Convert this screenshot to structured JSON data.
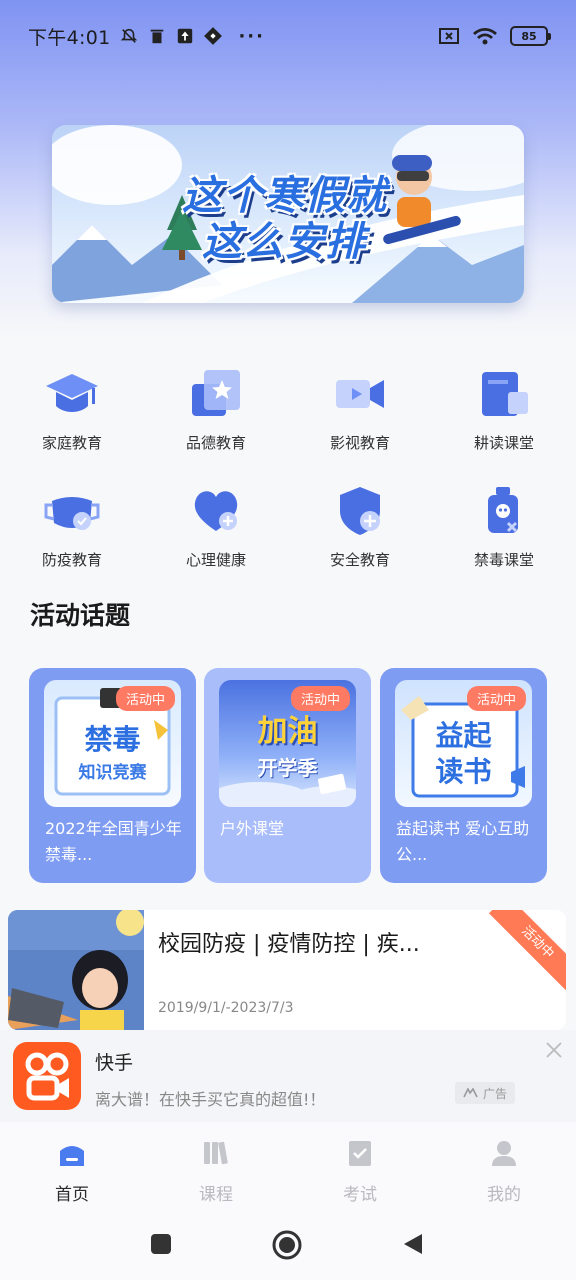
{
  "status_bar": {
    "time": "下午4:01",
    "dots": "···",
    "battery": "85"
  },
  "banner": {
    "line1": "这个寒假就",
    "line2": "这么安排"
  },
  "categories": [
    {
      "label": "家庭教育",
      "icon": "graduation-cap-icon"
    },
    {
      "label": "品德教育",
      "icon": "star-card-icon"
    },
    {
      "label": "影视教育",
      "icon": "video-camera-icon"
    },
    {
      "label": "耕读课堂",
      "icon": "book-icon"
    },
    {
      "label": "防疫教育",
      "icon": "mask-icon"
    },
    {
      "label": "心理健康",
      "icon": "heart-plus-icon"
    },
    {
      "label": "安全教育",
      "icon": "shield-plus-icon"
    },
    {
      "label": "禁毒课堂",
      "icon": "poison-bottle-icon"
    }
  ],
  "section_title": "活动话题",
  "activities": [
    {
      "badge": "活动中",
      "thumb_line1": "禁毒",
      "thumb_line2": "知识竞赛",
      "text": "2022年全国青少年禁毒..."
    },
    {
      "badge": "活动中",
      "thumb_line1": "加油",
      "thumb_line2": "开学季",
      "text": "户外课堂"
    },
    {
      "badge": "活动中",
      "thumb_line1": "益起",
      "thumb_line2": "读书",
      "text": "益起读书 爱心互助公..."
    }
  ],
  "list_item": {
    "title": "校园防疫 | 疫情防控 | 疾...",
    "date": "2019/9/1/-2023/7/3",
    "ribbon": "活动中"
  },
  "ad": {
    "title": "快手",
    "description": "离大谱！在快手买它真的超值!！",
    "tag": "广告"
  },
  "bottom_nav": [
    {
      "label": "首页",
      "active": true
    },
    {
      "label": "课程",
      "active": false
    },
    {
      "label": "考试",
      "active": false
    },
    {
      "label": "我的",
      "active": false
    }
  ],
  "colors": {
    "accent_blue": "#4a7cf0",
    "badge_orange": "#ff7a63",
    "ad_orange": "#ff5a1f"
  }
}
